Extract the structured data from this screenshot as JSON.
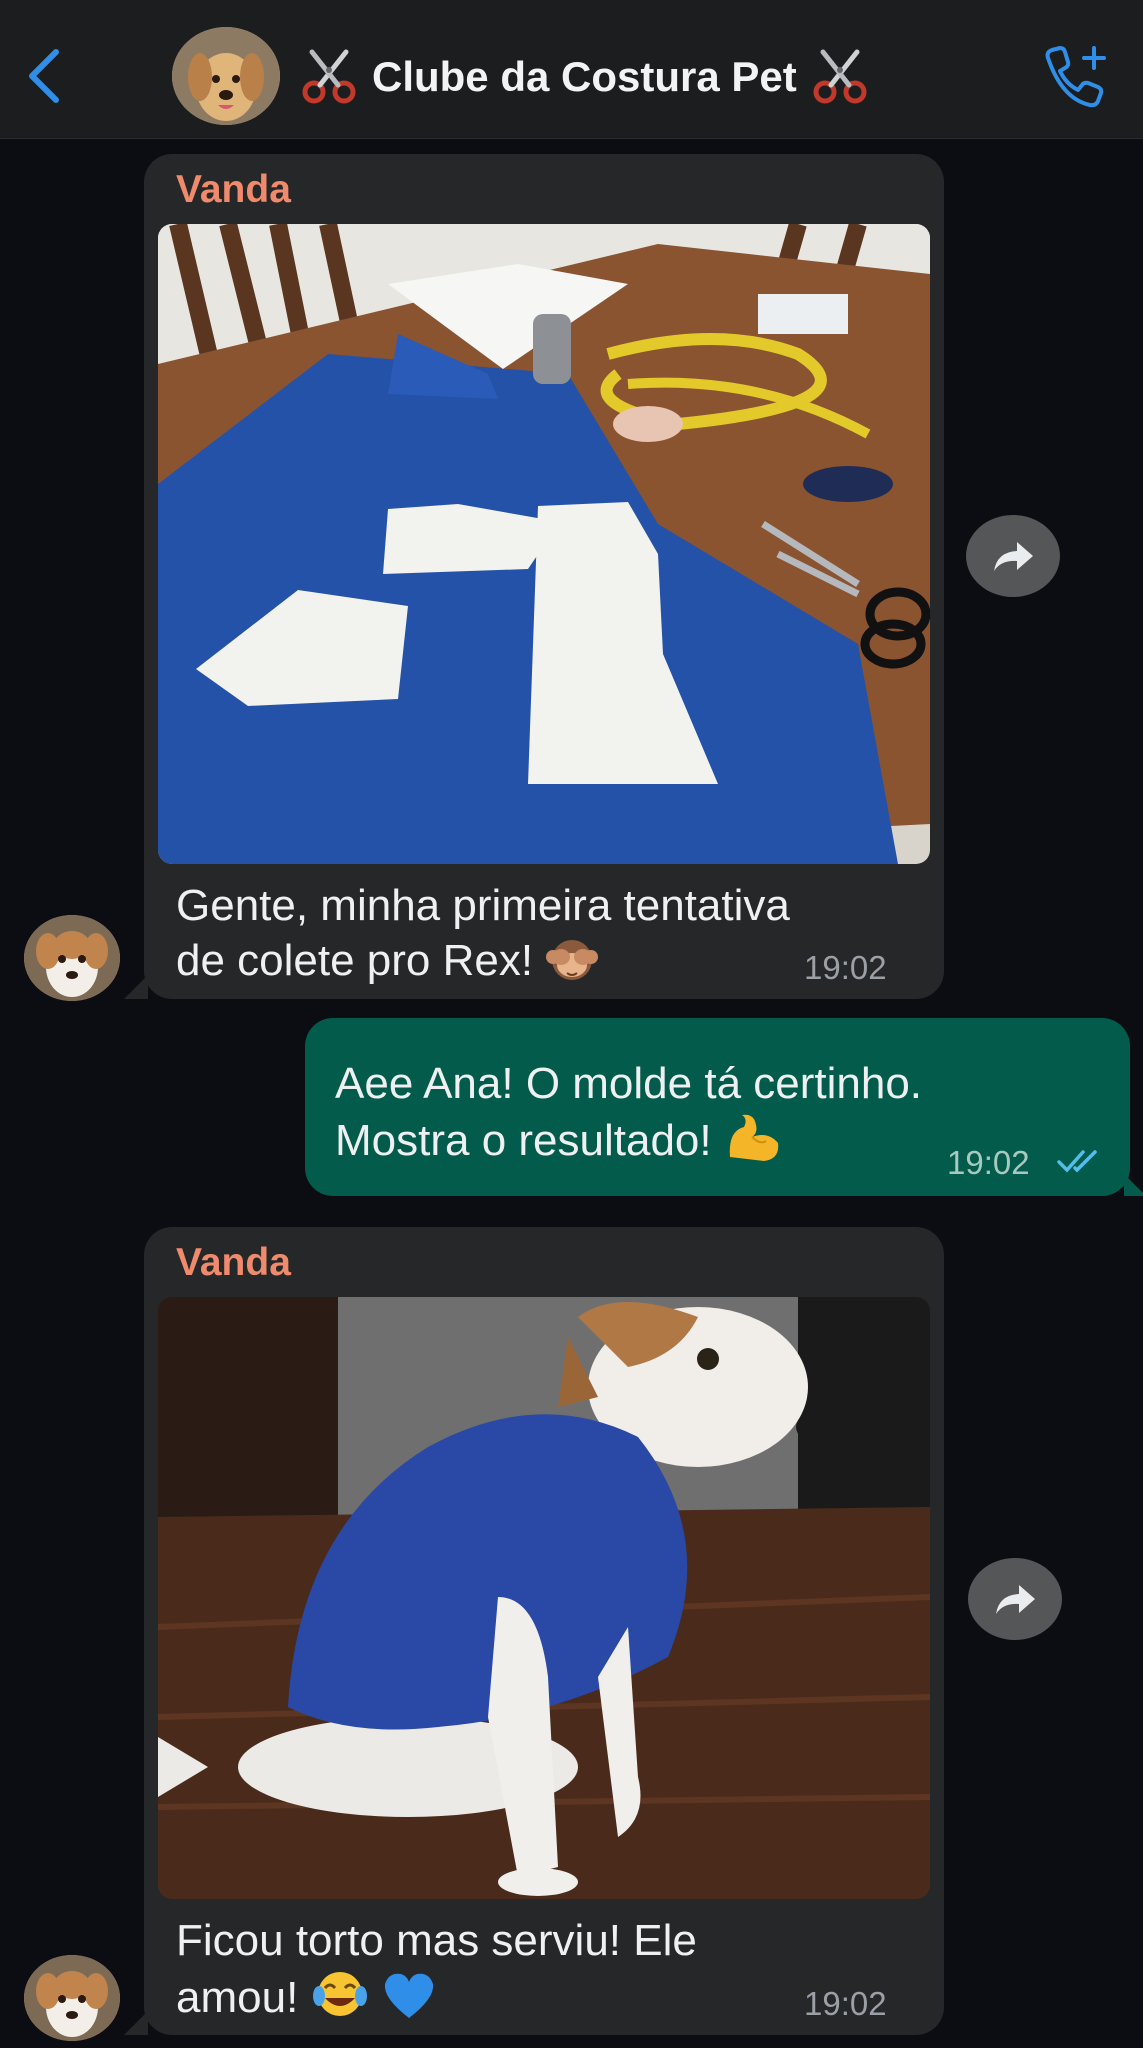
{
  "header": {
    "title": "Clube da Costura Pet",
    "back_icon": "chevron-left-icon",
    "scissors_icon": "scissors-emoji",
    "call_icon": "add-call-icon"
  },
  "messages": [
    {
      "sender": "Vanda",
      "image": "sewing-pattern-photo",
      "text_line1": "Gente, minha primeira tentativa",
      "text_line2": "de colete pro Rex!",
      "emoji": "see-no-evil-monkey",
      "time": "19:02"
    },
    {
      "text_line1": "Aee Ana! O molde tá certinho.",
      "text_line2": "Mostra o resultado!",
      "emoji": "flexed-biceps",
      "time": "19:02",
      "status": "read"
    },
    {
      "sender": "Vanda",
      "image": "dog-in-blue-vest-photo",
      "text_line1": "Ficou torto mas serviu! Ele",
      "text_line2": "amou!",
      "emoji": "tears-of-joy, blue-heart",
      "time": "19:02"
    }
  ],
  "colors": {
    "incoming_bubble": "#262729",
    "outgoing_bubble": "#035c4b",
    "sender_name": "#f08a6c",
    "accent_blue": "#2f8fe8"
  }
}
